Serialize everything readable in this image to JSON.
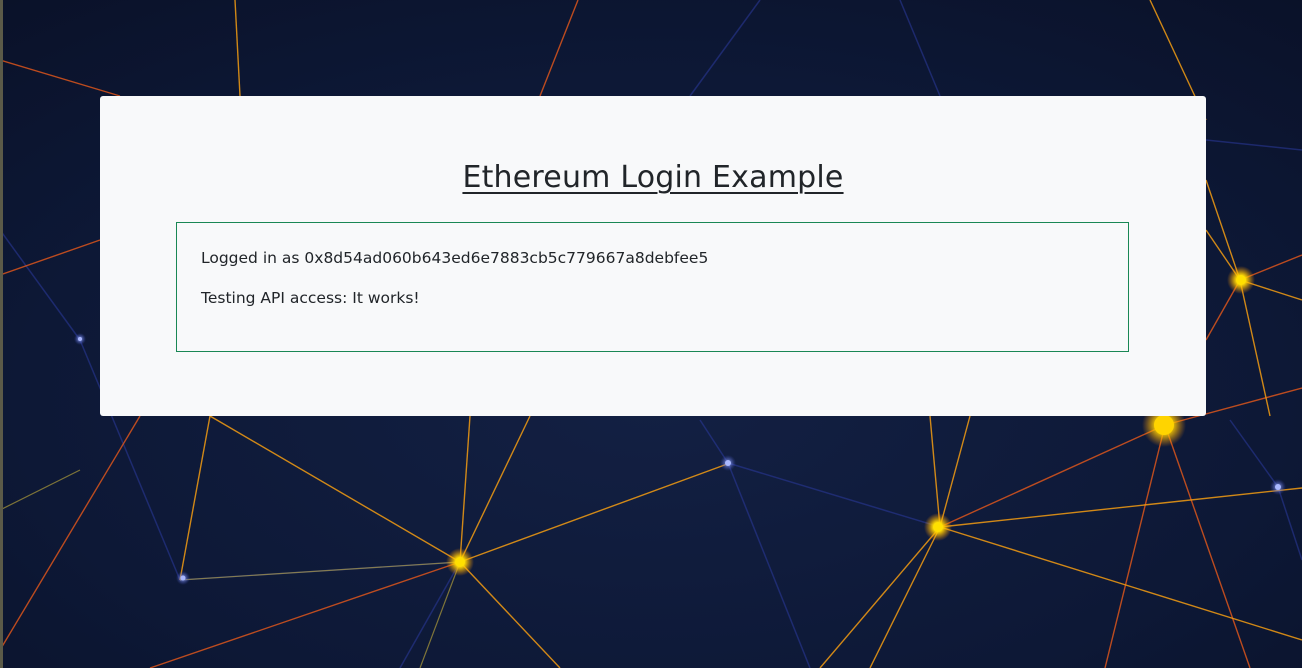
{
  "page": {
    "title": "Ethereum Login Example"
  },
  "status": {
    "logged_in_prefix": "Logged in as",
    "address": "0x8d54ad060b643ed6e7883cb5c779667a8debfee5",
    "api_test_text": "Testing API access: It works!",
    "border_color": "#198754"
  },
  "theme": {
    "background": "#0c1530",
    "card_background": "#f8f9fa",
    "text_color": "#212529",
    "network_line_colors": [
      "#f39c12",
      "#e8591a",
      "#f5c518",
      "#3a47b8"
    ],
    "node_color": "#ffd400"
  }
}
